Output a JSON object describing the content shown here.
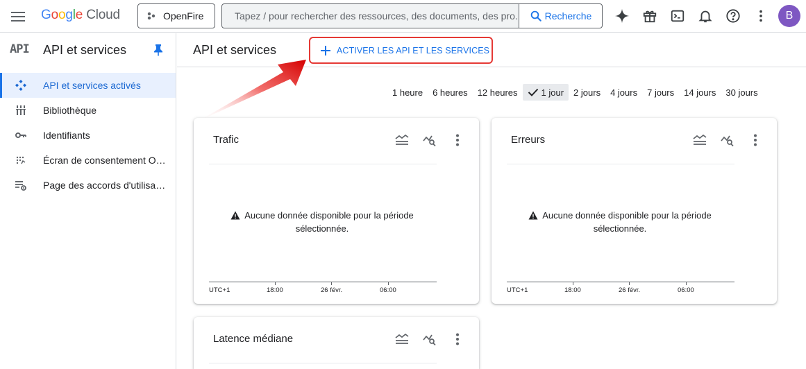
{
  "header": {
    "logo": {
      "g1": "G",
      "g2": "o",
      "g3": "o",
      "g4": "g",
      "g5": "l",
      "g6": "e",
      "cloud": "Cloud"
    },
    "project_name": "OpenFire",
    "search_placeholder": "Tapez / pour rechercher des ressources, des documents, des pro...",
    "search_button": "Recherche",
    "avatar_initial": "B"
  },
  "sidebar": {
    "logo_text": "API",
    "title": "API et services",
    "items": [
      {
        "label": "API et services activés",
        "icon": "api-diamond-icon",
        "active": true
      },
      {
        "label": "Bibliothèque",
        "icon": "library-icon",
        "active": false
      },
      {
        "label": "Identifiants",
        "icon": "key-icon",
        "active": false
      },
      {
        "label": "Écran de consentement OAuth",
        "icon": "consent-icon",
        "active": false
      },
      {
        "label": "Page des accords d'utilisation",
        "icon": "agreements-icon",
        "active": false
      }
    ]
  },
  "main": {
    "title": "API et services",
    "enable_button": "ACTIVER LES API ET LES SERVICES",
    "time_ranges": [
      "1 heure",
      "6 heures",
      "12 heures",
      "1 jour",
      "2 jours",
      "4 jours",
      "7 jours",
      "14 jours",
      "30 jours"
    ],
    "selected_range": "1 jour",
    "no_data_line1": "Aucune donnée disponible pour la période",
    "no_data_line2": "sélectionnée.",
    "axis_labels": [
      "UTC+1",
      "18:00",
      "26 févr.",
      "06:00"
    ],
    "cards": [
      {
        "title": "Trafic"
      },
      {
        "title": "Erreurs"
      },
      {
        "title": "Latence médiane"
      }
    ]
  },
  "colors": {
    "accent": "#1a73e8",
    "highlight": "#e53935",
    "avatar": "#7e57c2"
  }
}
